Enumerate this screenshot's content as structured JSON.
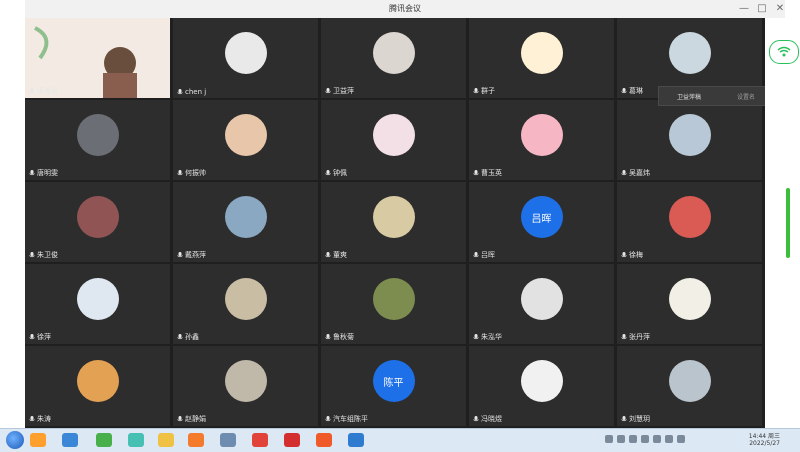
{
  "window": {
    "title": "腾讯会议"
  },
  "window_controls": {
    "minimize": "—",
    "maximize": "□",
    "close": "✕"
  },
  "participants": [
    {
      "name": "唐善凤",
      "avatar": "video-feed"
    },
    {
      "name": "chen j",
      "avatar": "photo-woman"
    },
    {
      "name": "卫益萍",
      "avatar": "photo-man"
    },
    {
      "name": "群子",
      "avatar": "sunflower"
    },
    {
      "name": "葛琳",
      "avatar": "photo-sky"
    },
    {
      "name": "唐明雯",
      "avatar": "photo-building"
    },
    {
      "name": "何振帅",
      "avatar": "photo-girl"
    },
    {
      "name": "钟佩",
      "avatar": "photo-baby"
    },
    {
      "name": "曹玉英",
      "avatar": "photo-pink"
    },
    {
      "name": "吴嘉炜",
      "avatar": "photo-group"
    },
    {
      "name": "朱卫俊",
      "avatar": "photo-sunset"
    },
    {
      "name": "戴燕萍",
      "avatar": "photo-sea"
    },
    {
      "name": "董爽",
      "avatar": "photo-kids"
    },
    {
      "name": "吕晖",
      "avatar": "initial",
      "initial": "吕晖"
    },
    {
      "name": "徐梅",
      "avatar": "photo-red"
    },
    {
      "name": "徐萍",
      "avatar": "photo-boy"
    },
    {
      "name": "孙鑫",
      "avatar": "photo-hands"
    },
    {
      "name": "鲁秋菊",
      "avatar": "flower-pink"
    },
    {
      "name": "朱泓华",
      "avatar": "photo-cat"
    },
    {
      "name": "张丹萍",
      "avatar": "photo-cartoon"
    },
    {
      "name": "朱涛",
      "avatar": "photo-sunrise"
    },
    {
      "name": "赵静娟",
      "avatar": "photo-couple"
    },
    {
      "name": "汽车组陈平",
      "avatar": "initial",
      "initial": "陈平"
    },
    {
      "name": "冯晓煜",
      "avatar": "photo-husky"
    },
    {
      "name": "刘慧玥",
      "avatar": "photo-lake"
    }
  ],
  "popup": {
    "label": "卫益萍稿",
    "action": "设置名"
  },
  "taskbar": {
    "time": "14:44 周三",
    "date": "2022/5/27"
  }
}
